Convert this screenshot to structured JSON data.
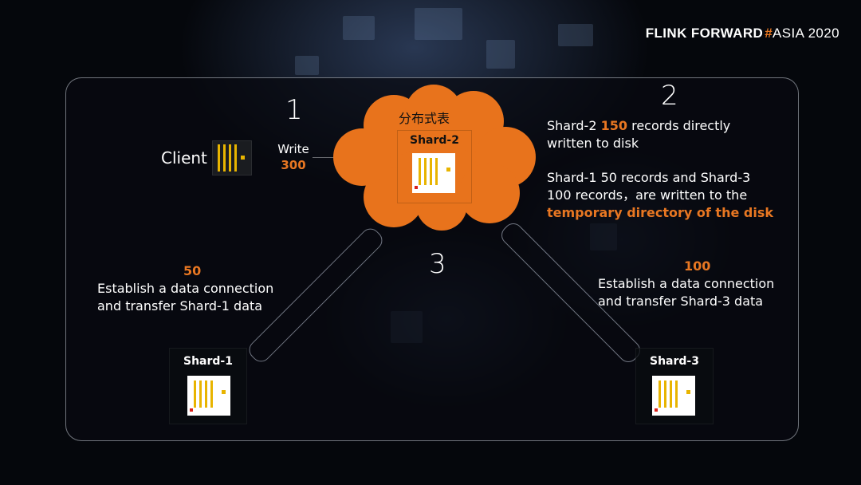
{
  "brand": {
    "part1": "FLINK FORWARD",
    "hash": "#",
    "part2": "ASIA 2020"
  },
  "steps": {
    "one": "1",
    "two": "2",
    "three": "3"
  },
  "client": {
    "label": "Client"
  },
  "write": {
    "label": "Write",
    "count": "300"
  },
  "cloud": {
    "label": "分布式表"
  },
  "shards": {
    "shard2": "Shard-2",
    "shard1": "Shard-1",
    "shard3": "Shard-3"
  },
  "step2_text": {
    "line1_prefix": "Shard-2 ",
    "line1_num": "150",
    "line1_suffix": " records directly",
    "line2": "written to disk",
    "line3": "Shard-1 50 records and Shard-3",
    "line4": "100 records，are written to the",
    "line5": "temporary directory of the disk"
  },
  "left_text": {
    "count": "50",
    "line1": "Establish a data connection",
    "line2": "and transfer Shard-1 data"
  },
  "right_text": {
    "count": "100",
    "line1": "Establish a data connection",
    "line2": "and transfer Shard-3 data"
  },
  "colors": {
    "accent": "#e87722",
    "kafka_bar": "#e8b400",
    "kafka_dot": "#d8201a"
  },
  "icons": {
    "client": "kafka-icon",
    "shard": "kafka-icon",
    "cloud": "cloud-shape"
  }
}
